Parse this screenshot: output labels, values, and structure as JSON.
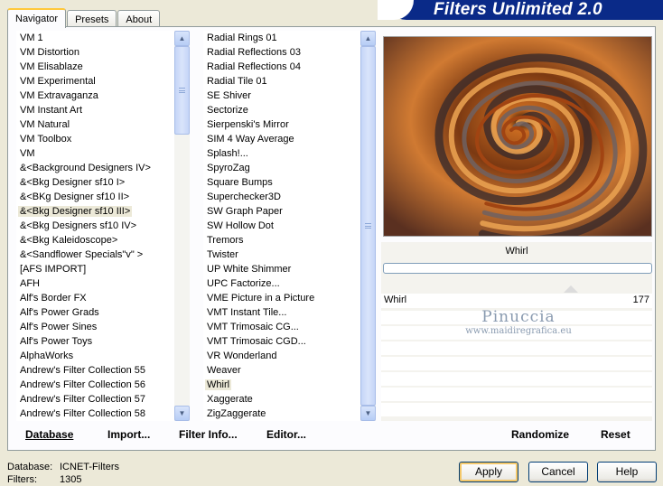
{
  "app": {
    "brand": "Filters Unlimited 2.0"
  },
  "tabs": [
    {
      "label": "Navigator",
      "active": true
    },
    {
      "label": "Presets",
      "active": false
    },
    {
      "label": "About",
      "active": false
    }
  ],
  "categories": [
    "VM 1",
    "VM Distortion",
    "VM Elisablaze",
    "VM Experimental",
    "VM Extravaganza",
    "VM Instant Art",
    "VM Natural",
    "VM Toolbox",
    "VM",
    "&<Background Designers IV>",
    "&<Bkg Designer sf10 I>",
    "&<BKg Designer sf10 II>",
    "&<Bkg Designer sf10 III>",
    "&<Bkg Designers sf10 IV>",
    "&<Bkg Kaleidoscope>",
    "&<Sandflower Specials\"v\" >",
    "[AFS IMPORT]",
    "AFH",
    "Alf's Border FX",
    "Alf's Power Grads",
    "Alf's Power Sines",
    "Alf's Power Toys",
    "AlphaWorks",
    "Andrew's Filter Collection 55",
    "Andrew's Filter Collection 56",
    "Andrew's Filter Collection 57",
    "Andrew's Filter Collection 58"
  ],
  "selected_category": "&<Bkg Designer sf10 III>",
  "filters": [
    "Radial  Rings 01",
    "Radial Reflections 03",
    "Radial Reflections 04",
    "Radial Tile 01",
    "SE Shiver",
    "Sectorize",
    "Sierpenski's Mirror",
    "SIM 4 Way Average",
    "Splash!...",
    "SpyroZag",
    "Square Bumps",
    "Superchecker3D",
    "SW Graph Paper",
    "SW Hollow Dot",
    "Tremors",
    "Twister",
    "UP White Shimmer",
    "UPC Factorize...",
    "VME Picture in a Picture",
    "VMT Instant Tile...",
    "VMT Trimosaic CG...",
    "VMT Trimosaic CGD...",
    "VR Wonderland",
    "Weaver",
    "Whirl",
    "Xaggerate",
    "ZigZaggerate"
  ],
  "selected_filter": "Whirl",
  "param_panel": {
    "filter_name": "Whirl",
    "slider_label": "Whirl",
    "slider_value": "177"
  },
  "watermark": {
    "line1": "Pinuccia",
    "line2": "www.maidiregrafica.eu"
  },
  "links": {
    "database": "Database",
    "import": "Import...",
    "filter_info": "Filter Info...",
    "editor": "Editor...",
    "randomize": "Randomize",
    "reset": "Reset"
  },
  "status": {
    "database_label": "Database:",
    "database_value": "ICNET-Filters",
    "filters_label": "Filters:",
    "filters_value": "1305"
  },
  "buttons": {
    "apply": "Apply",
    "cancel": "Cancel",
    "help": "Help"
  },
  "colors": {
    "banner": "#0a2a88",
    "window_bg": "#ece9d8",
    "tab_accent": "#ffc83c"
  }
}
